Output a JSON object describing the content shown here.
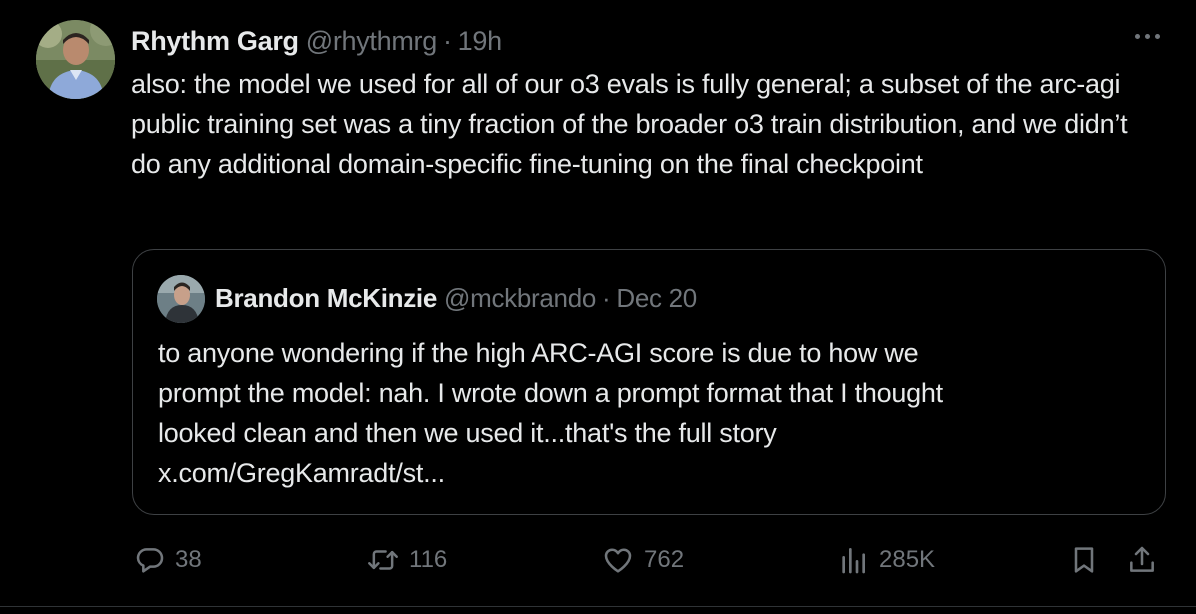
{
  "author": {
    "name": "Rhythm Garg",
    "handle": "@rhythmrg",
    "separator": "·",
    "time": "19h"
  },
  "tweet_text": "also: the model we used for all of our o3 evals is fully general; a subset of the arc-agi public training set was a tiny fraction of the broader o3 train distribution, and we didn’t do any additional domain-specific fine-tuning on the final checkpoint",
  "quoted": {
    "name": "Brandon McKinzie",
    "handle": "@mckbrando",
    "separator": "·",
    "time": "Dec 20",
    "lines": [
      "to anyone wondering if the high ARC-AGI score is due to how we",
      "prompt the model: nah. I wrote down a prompt format that I thought",
      "looked clean and then we used it...that's the full story",
      "x.com/GregKamradt/st..."
    ]
  },
  "actions": {
    "replies": "38",
    "reposts": "116",
    "likes": "762",
    "views": "285K"
  },
  "icons": {
    "more": "more-dots-icon",
    "reply": "reply-bubble-icon",
    "repost": "repost-arrows-icon",
    "like": "heart-icon",
    "views": "bar-chart-icon",
    "bookmark": "bookmark-icon",
    "share": "share-upload-icon"
  },
  "colors": {
    "background": "#000000",
    "text_primary": "#e7e9ea",
    "text_secondary": "#71767b",
    "border": "#3e4144"
  }
}
